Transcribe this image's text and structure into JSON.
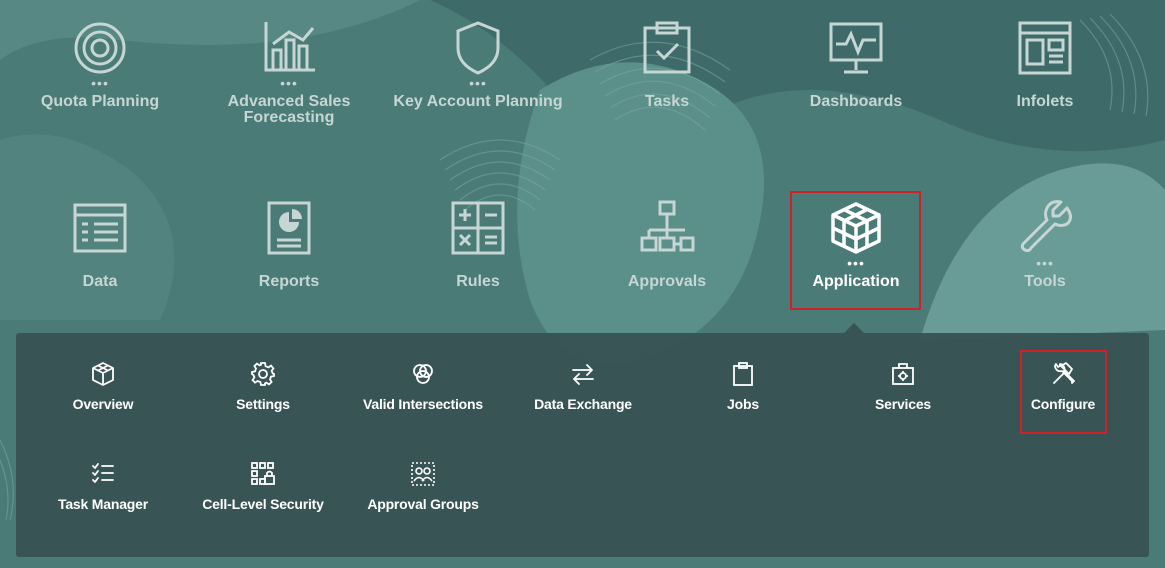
{
  "nav": {
    "items": [
      {
        "label": "Quota Planning",
        "icon": "target-icon"
      },
      {
        "label": "Advanced Sales Forecasting",
        "icon": "bar-chart-icon"
      },
      {
        "label": "Key Account Planning",
        "icon": "shield-icon"
      },
      {
        "label": "Tasks",
        "icon": "clipboard-check-icon"
      },
      {
        "label": "Dashboards",
        "icon": "monitor-pulse-icon"
      },
      {
        "label": "Infolets",
        "icon": "infolet-layout-icon"
      },
      {
        "label": "Data",
        "icon": "data-grid-icon"
      },
      {
        "label": "Reports",
        "icon": "report-pie-icon"
      },
      {
        "label": "Rules",
        "icon": "calculator-icon"
      },
      {
        "label": "Approvals",
        "icon": "hierarchy-icon"
      },
      {
        "label": "Application",
        "icon": "cube-icon",
        "selected": true
      },
      {
        "label": "Tools",
        "icon": "wrench-icon"
      }
    ]
  },
  "application_menu": {
    "items": [
      {
        "label": "Overview",
        "icon": "cube-icon"
      },
      {
        "label": "Settings",
        "icon": "gear-icon"
      },
      {
        "label": "Valid Intersections",
        "icon": "intersections-icon"
      },
      {
        "label": "Data Exchange",
        "icon": "exchange-arrows-icon"
      },
      {
        "label": "Jobs",
        "icon": "clipboard-icon"
      },
      {
        "label": "Services",
        "icon": "toolbox-icon"
      },
      {
        "label": "Configure",
        "icon": "tools-icon",
        "highlighted": true
      },
      {
        "label": "Task Manager",
        "icon": "checklist-icon"
      },
      {
        "label": "Cell-Level Security",
        "icon": "grid-lock-icon"
      },
      {
        "label": "Approval Groups",
        "icon": "group-icon"
      }
    ]
  },
  "colors": {
    "background": "#4b7b77",
    "panel": "#375152",
    "label": "#c6d6d4",
    "highlight": "#d0202a"
  }
}
